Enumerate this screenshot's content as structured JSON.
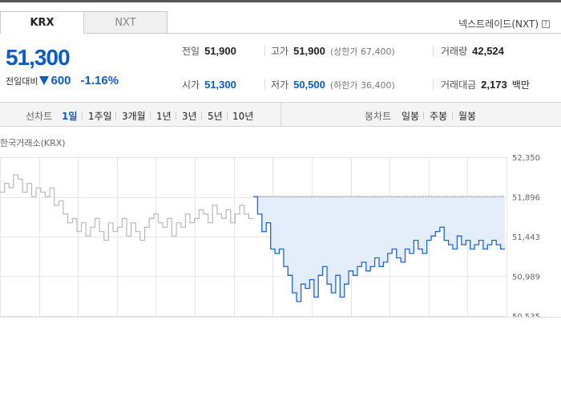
{
  "tabs": [
    {
      "label": "KRX",
      "active": true
    },
    {
      "label": "NXT",
      "active": false
    }
  ],
  "nxt_trade_label": "넥스트레이드(NXT)",
  "help_icon_glyph": "?",
  "price": {
    "current": "51,300",
    "change_label": "전일대비",
    "change_amount": "600",
    "change_rate": "-1.16%",
    "direction": "down",
    "color": "#0a5cc8"
  },
  "info": {
    "prev_close": {
      "label": "전일",
      "value": "51,900"
    },
    "open": {
      "label": "시가",
      "value": "51,300"
    },
    "high": {
      "label": "고가",
      "value": "51,900",
      "sub": "(상한가 67,400)"
    },
    "low": {
      "label": "저가",
      "value": "50,500",
      "sub": "(하한가 36,400)"
    },
    "volume": {
      "label": "거래량",
      "value": "42,524"
    },
    "amount": {
      "label": "거래대금",
      "value": "2,173",
      "unit": "백만"
    }
  },
  "period_bar": {
    "line_label": "선차트",
    "line_periods": [
      "1일",
      "1주일",
      "3개월",
      "1년",
      "3년",
      "5년",
      "10년"
    ],
    "active_period": "1일",
    "candle_label": "봉차트",
    "candle_periods": [
      "일봉",
      "주봉",
      "월봉"
    ]
  },
  "market_label": "한국거래소(KRX)",
  "chart_data": {
    "type": "line",
    "ylim": [
      50535,
      52350
    ],
    "y_ticks": [
      "52,350",
      "51,896",
      "51,443",
      "50,989",
      "50,535"
    ],
    "grid": true,
    "reference_line": 51900,
    "series": [
      {
        "role": "previous-day",
        "color": "#b8b8b8",
        "values": [
          51950,
          52050,
          52000,
          52150,
          52100,
          51950,
          52050,
          51900,
          52000,
          51950,
          51900,
          52000,
          51800,
          51850,
          51700,
          51600,
          51650,
          51500,
          51600,
          51450,
          51550,
          51650,
          51500,
          51400,
          51600,
          51500,
          51550,
          51650,
          51450,
          51600,
          51500,
          51400,
          51550,
          51650,
          51700,
          51600,
          51550,
          51650,
          51450,
          51600,
          51550,
          51700,
          51600,
          51650,
          51750,
          51700,
          51600,
          51800,
          51700,
          51650,
          51750,
          51600,
          51700,
          51800,
          51700,
          51650
        ]
      },
      {
        "role": "today",
        "color": "#1c66d6",
        "fill": "#e4eefb",
        "values": [
          51900,
          51700,
          51500,
          51600,
          51300,
          51250,
          51300,
          51100,
          51000,
          50800,
          50700,
          50900,
          50850,
          50950,
          50750,
          51000,
          51100,
          50900,
          50800,
          51000,
          50750,
          50900,
          51050,
          51000,
          51100,
          51150,
          51050,
          51100,
          51200,
          51100,
          51150,
          51250,
          51300,
          51200,
          51150,
          51300,
          51250,
          51400,
          51300,
          51250,
          51400,
          51450,
          51500,
          51550,
          51400,
          51350,
          51300,
          51450,
          51350,
          51400,
          51300,
          51350,
          51400,
          51300,
          51350,
          51400,
          51350,
          51300
        ]
      }
    ]
  }
}
